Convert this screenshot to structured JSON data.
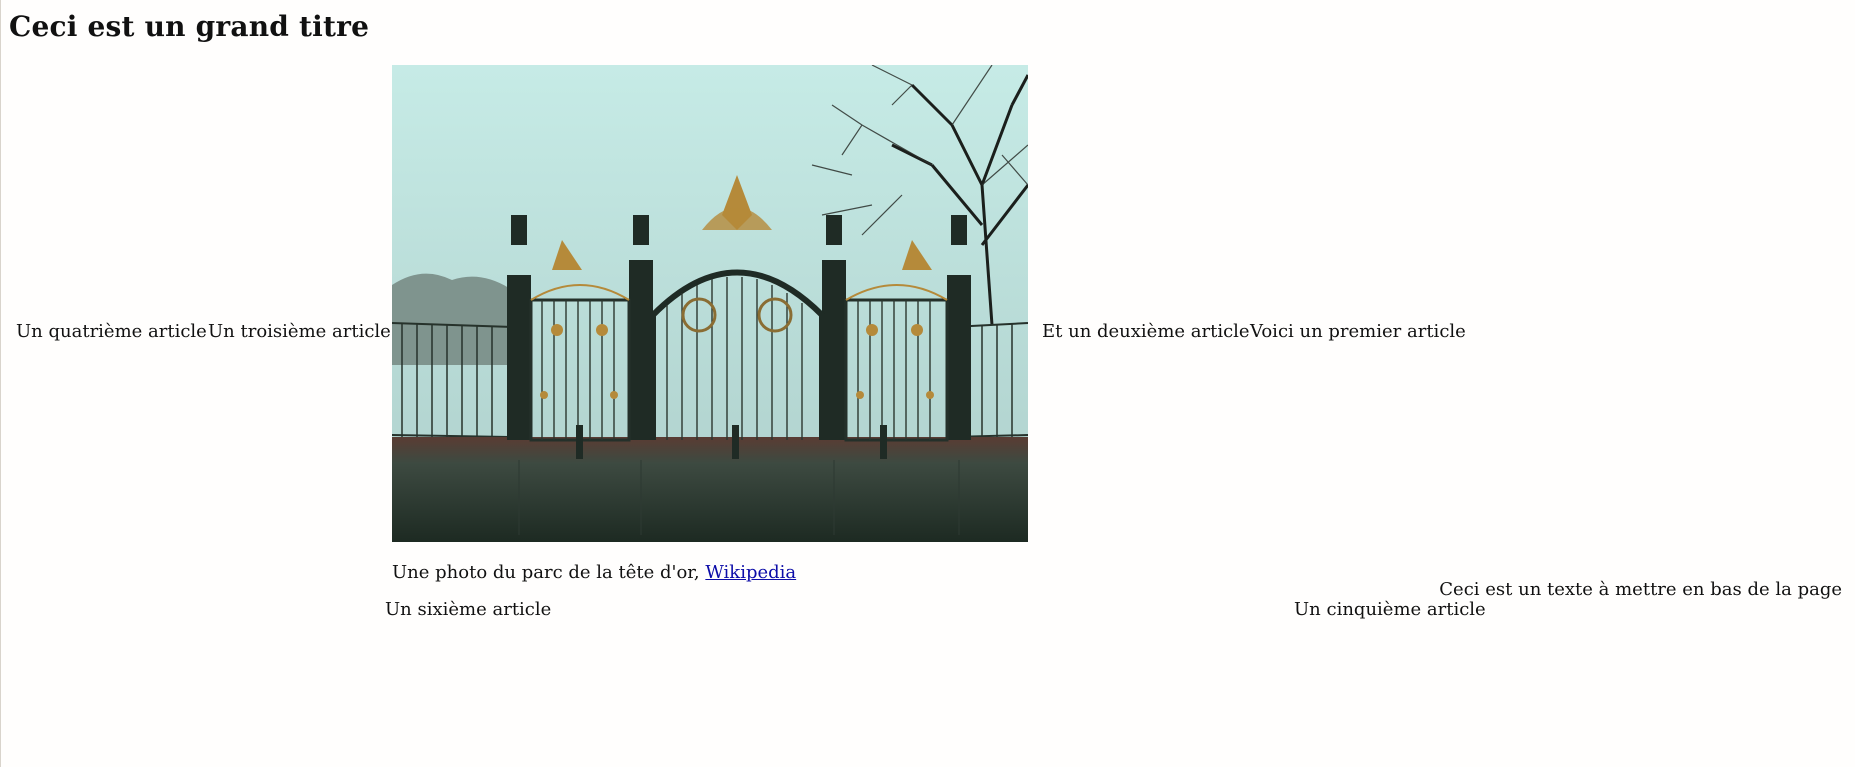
{
  "page": {
    "title": "Ceci est un grand titre"
  },
  "articles": {
    "first": "Voici un premier article",
    "second": "Et un deuxième article",
    "third": "Un troisième article",
    "fourth": "Un quatrième article",
    "fifth": "Un cinquième article",
    "sixth": "Un sixième article"
  },
  "figure": {
    "caption_text": "Une photo du parc de la tête d'or, ",
    "caption_link": "Wikipedia"
  },
  "footer": {
    "text": "Ceci est un texte à mettre en bas de la page"
  },
  "colors": {
    "link": "#0c0ca8",
    "sky": "#bfe2de",
    "gate_dark": "#1f2b25",
    "gold": "#b58a3a"
  }
}
